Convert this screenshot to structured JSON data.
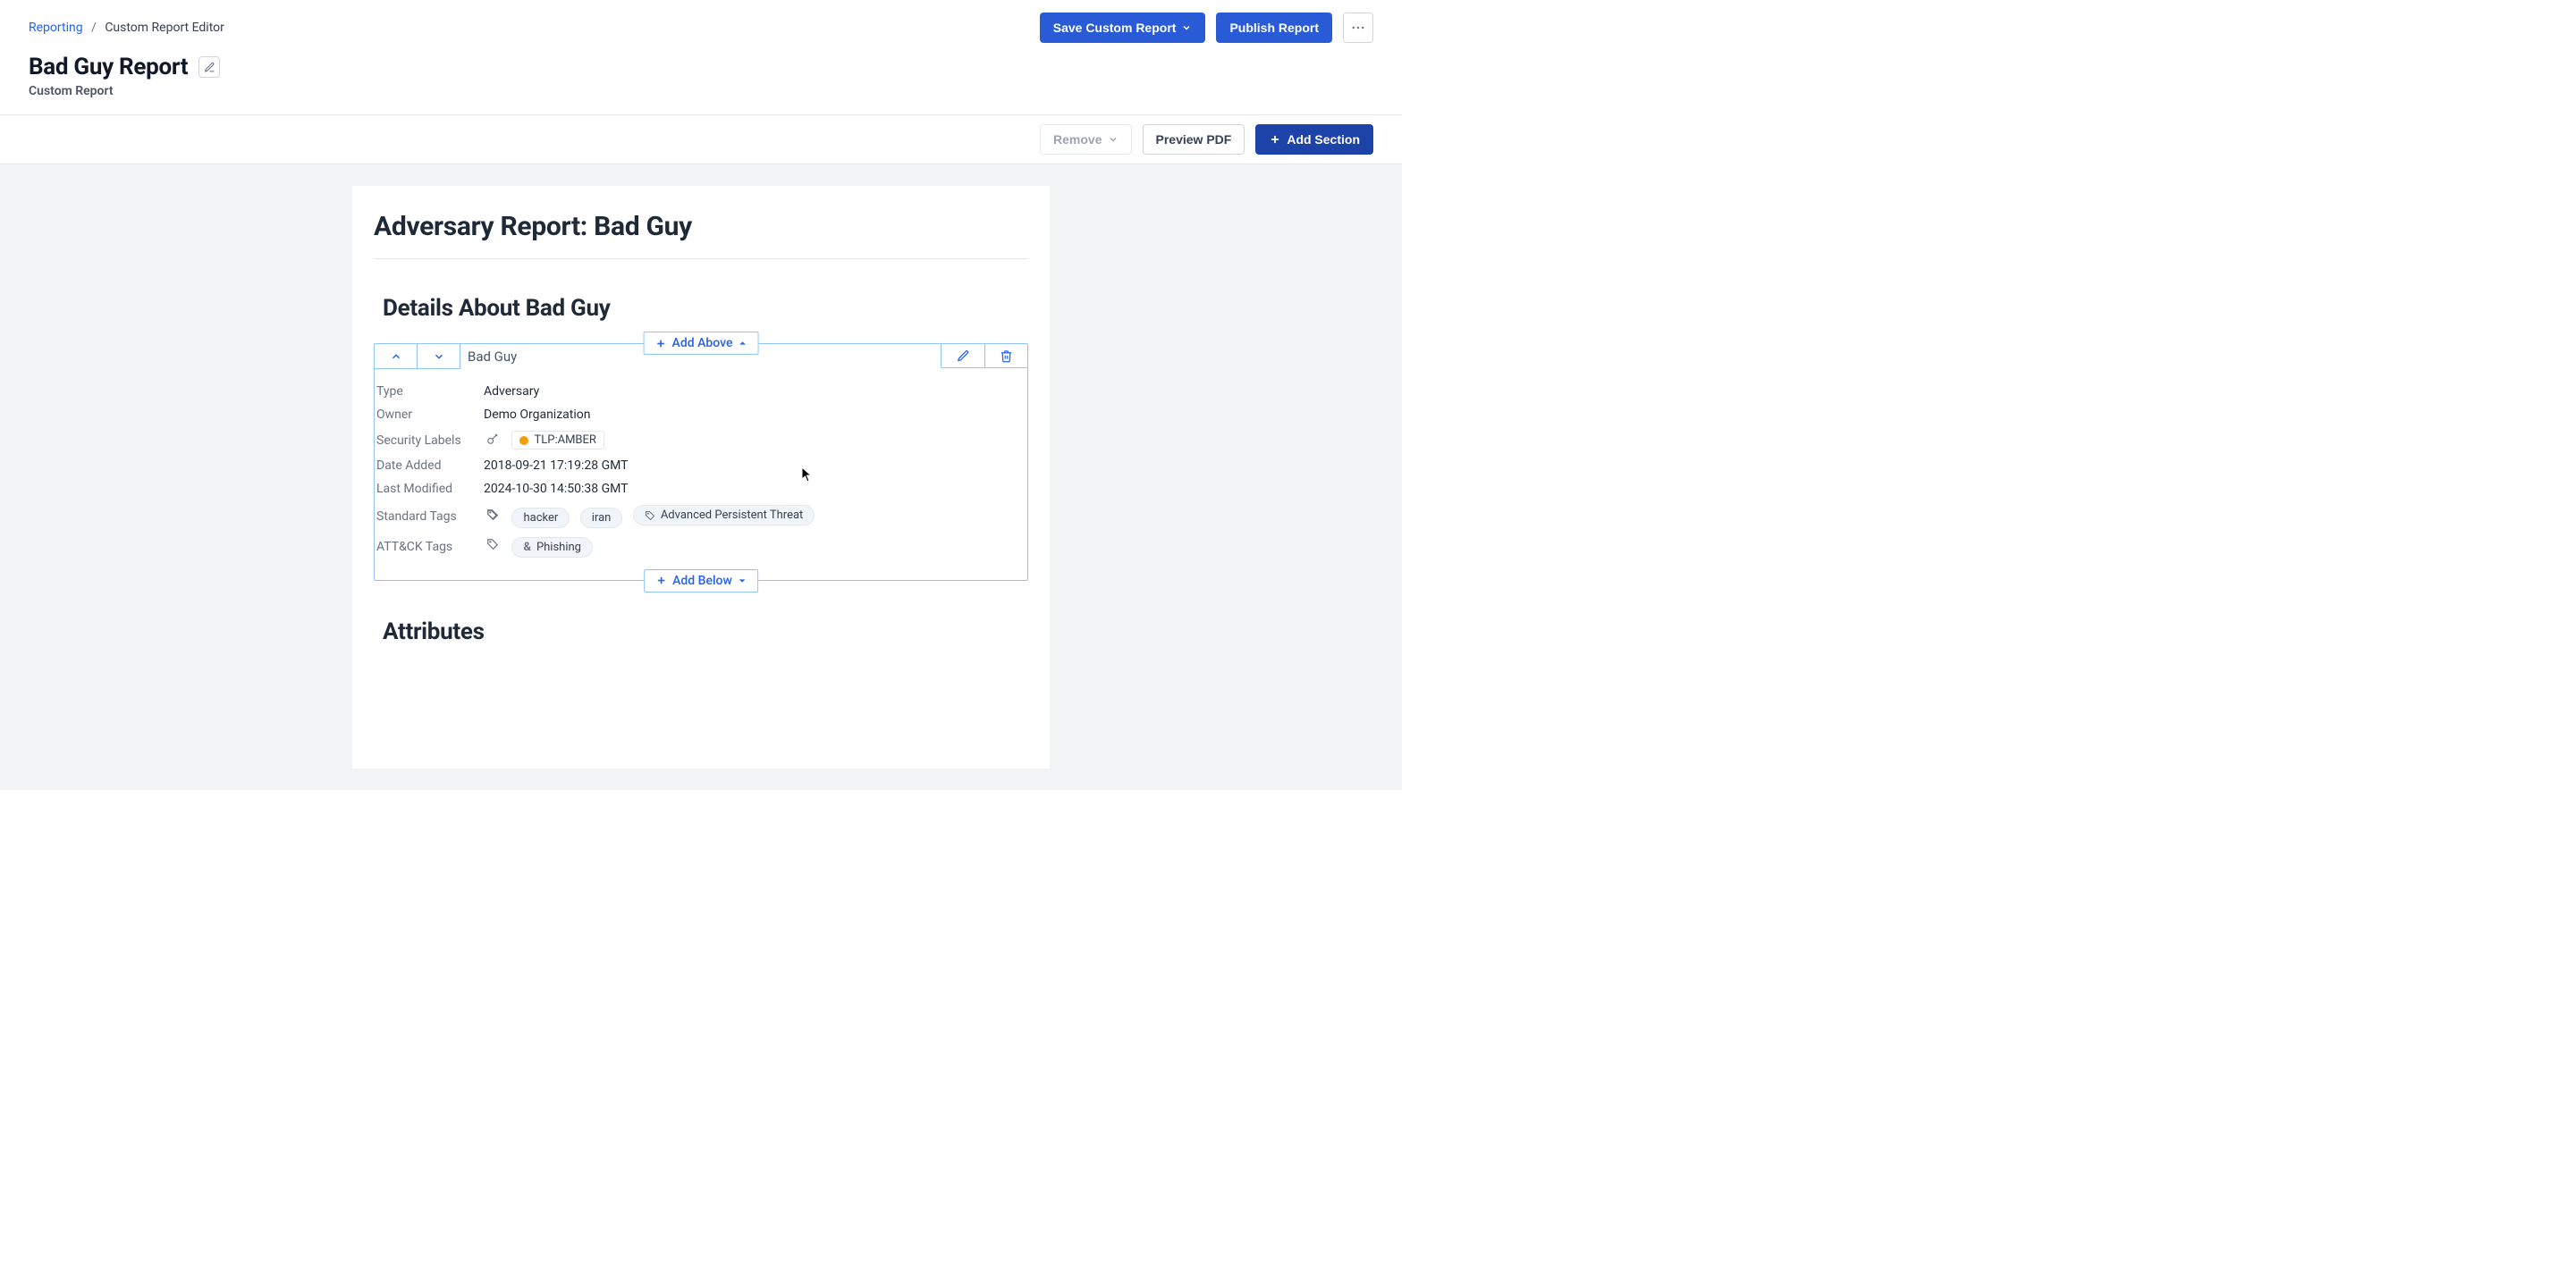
{
  "breadcrumb": {
    "root": "Reporting",
    "current": "Custom Report Editor"
  },
  "header": {
    "save_label": "Save Custom Report",
    "publish_label": "Publish Report",
    "title": "Bad Guy Report",
    "subtitle": "Custom Report"
  },
  "toolbar": {
    "remove_label": "Remove",
    "preview_label": "Preview PDF",
    "add_section_label": "Add Section"
  },
  "report": {
    "title": "Adversary Report: Bad Guy",
    "section_title": "Details About Bad Guy",
    "card": {
      "name": "Bad Guy",
      "add_above": "Add Above",
      "add_below": "Add Below",
      "fields": {
        "type_label": "Type",
        "type_value": "Adversary",
        "owner_label": "Owner",
        "owner_value": "Demo Organization",
        "security_labels_label": "Security Labels",
        "security_labels_value": "TLP:AMBER",
        "date_added_label": "Date Added",
        "date_added_value": "2018-09-21 17:19:28 GMT",
        "last_modified_label": "Last Modified",
        "last_modified_value": "2024-10-30 14:50:38 GMT",
        "standard_tags_label": "Standard Tags",
        "standard_tags": [
          "hacker",
          "iran",
          "Advanced Persistent Threat"
        ],
        "attack_tags_label": "ATT&CK Tags",
        "attack_tags": [
          "Phishing"
        ]
      }
    },
    "attributes_heading": "Attributes"
  }
}
